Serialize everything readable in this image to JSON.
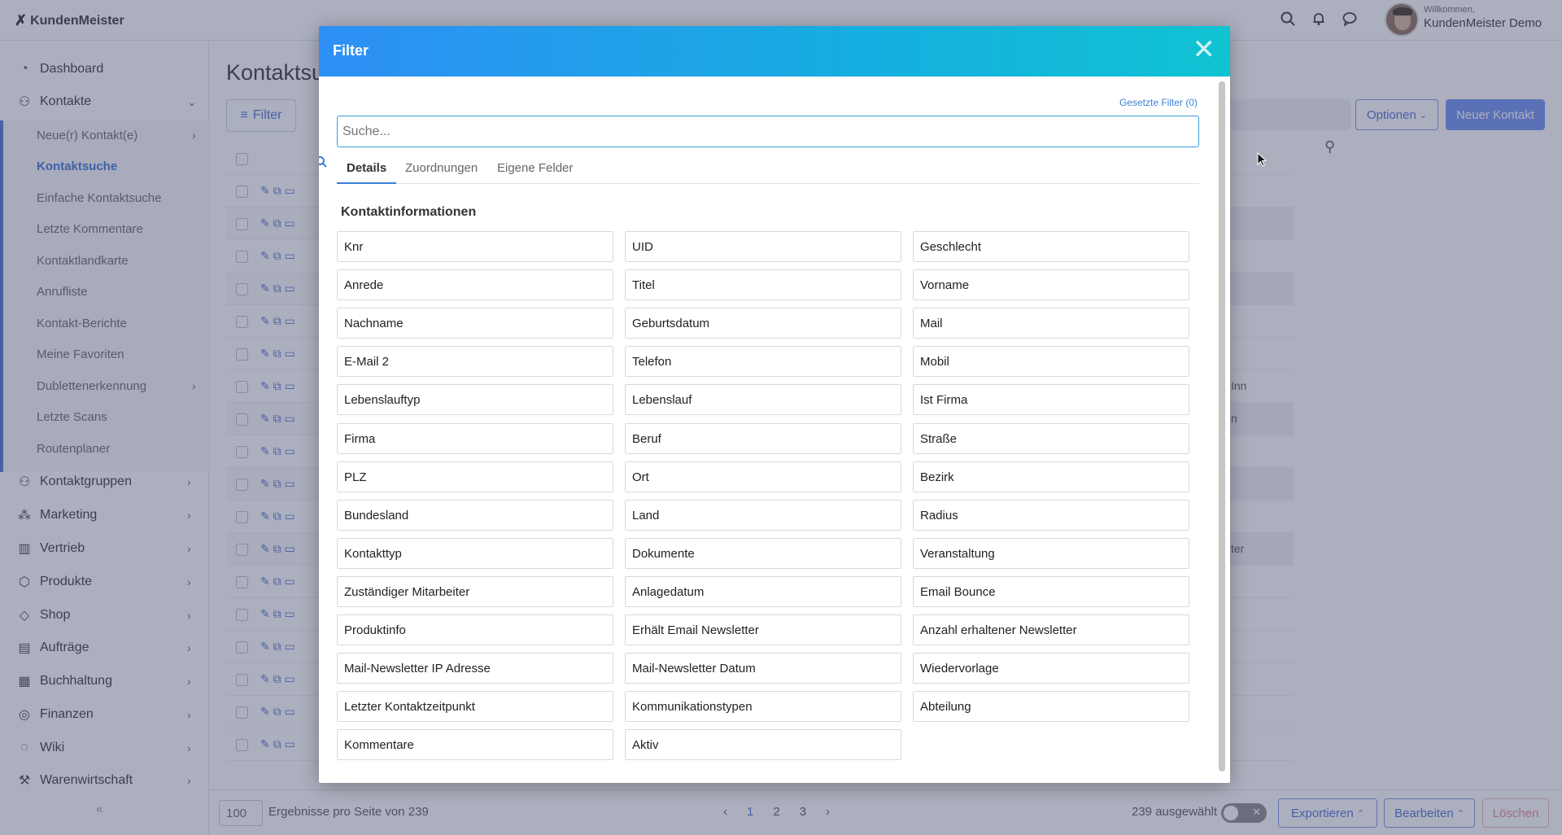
{
  "app": {
    "logo": "KundenMeister"
  },
  "user": {
    "welcome": "Willkommen,",
    "name": "KundenMeister Demo"
  },
  "icons": [
    "search-icon",
    "bell-icon",
    "chat-icon"
  ],
  "sidebar": {
    "items": [
      {
        "label": "Dashboard",
        "icon": "dashboard-icon"
      },
      {
        "label": "Kontakte",
        "icon": "contacts-icon"
      },
      {
        "label": "Kontaktgruppen",
        "icon": "groups-icon"
      },
      {
        "label": "Marketing",
        "icon": "marketing-icon"
      },
      {
        "label": "Vertrieb",
        "icon": "chart-icon"
      },
      {
        "label": "Produkte",
        "icon": "box-icon"
      },
      {
        "label": "Shop",
        "icon": "tag-icon"
      },
      {
        "label": "Aufträge",
        "icon": "orders-icon"
      },
      {
        "label": "Buchhaltung",
        "icon": "table-icon"
      },
      {
        "label": "Finanzen",
        "icon": "coins-icon"
      },
      {
        "label": "Wiki",
        "icon": "bulb-icon"
      },
      {
        "label": "Warenwirtschaft",
        "icon": "warehouse-icon"
      }
    ],
    "sub_items": [
      "Neue(r) Kontakt(e)",
      "Kontaktsuche",
      "Einfache Kontaktsuche",
      "Letzte Kommentare",
      "Kontaktlandkarte",
      "Anrufliste",
      "Kontakt-Berichte",
      "Meine Favoriten",
      "Dublettenerkennung",
      "Letzte Scans",
      "Routenplaner"
    ],
    "collapse": "«"
  },
  "main": {
    "title": "Kontaktsu",
    "filter_button": "Filter",
    "options_button": "Optionen",
    "new_contact_button": "Neuer Kontakt",
    "row_tails": [
      "",
      "",
      "",
      "",
      "",
      "",
      "Inn",
      "n",
      "",
      "",
      "",
      "ter",
      "",
      "",
      "",
      "",
      ""
    ]
  },
  "footer": {
    "page_size": "100",
    "per_page_text": "Ergebnisse pro Seite von 239",
    "pages": [
      "‹",
      "1",
      "2",
      "3",
      "›"
    ],
    "selected": "239 ausgewählt",
    "export_button": "Exportieren",
    "edit_button": "Bearbeiten",
    "delete_button": "Löschen"
  },
  "modal": {
    "title": "Filter",
    "close": "✕",
    "set_filters": "Gesetzte Filter (0)",
    "search_placeholder": "Suche...",
    "tabs": [
      "Details",
      "Zuordnungen",
      "Eigene Felder"
    ],
    "section_title": "Kontaktinformationen",
    "fields": [
      "Knr",
      "UID",
      "Geschlecht",
      "Anrede",
      "Titel",
      "Vorname",
      "Nachname",
      "Geburtsdatum",
      "Mail",
      "E-Mail 2",
      "Telefon",
      "Mobil",
      "Lebenslauftyp",
      "Lebenslauf",
      "Ist Firma",
      "Firma",
      "Beruf",
      "Straße",
      "PLZ",
      "Ort",
      "Bezirk",
      "Bundesland",
      "Land",
      "Radius",
      "Kontakttyp",
      "Dokumente",
      "Veranstaltung",
      "Zuständiger Mitarbeiter",
      "Anlagedatum",
      "Email Bounce",
      "Produktinfo",
      "Erhält Email Newsletter",
      "Anzahl erhaltener Newsletter",
      "Mail-Newsletter IP Adresse",
      "Mail-Newsletter Datum",
      "Wiedervorlage",
      "Letzter Kontaktzeitpunkt",
      "Kommunikationstypen",
      "Abteilung",
      "Kommentare",
      "Aktiv"
    ]
  },
  "colors": {
    "accent": "#4a6fd8",
    "header_start": "#2d8ff5",
    "header_end": "#0fc3d2",
    "delete": "#e38c8c"
  }
}
